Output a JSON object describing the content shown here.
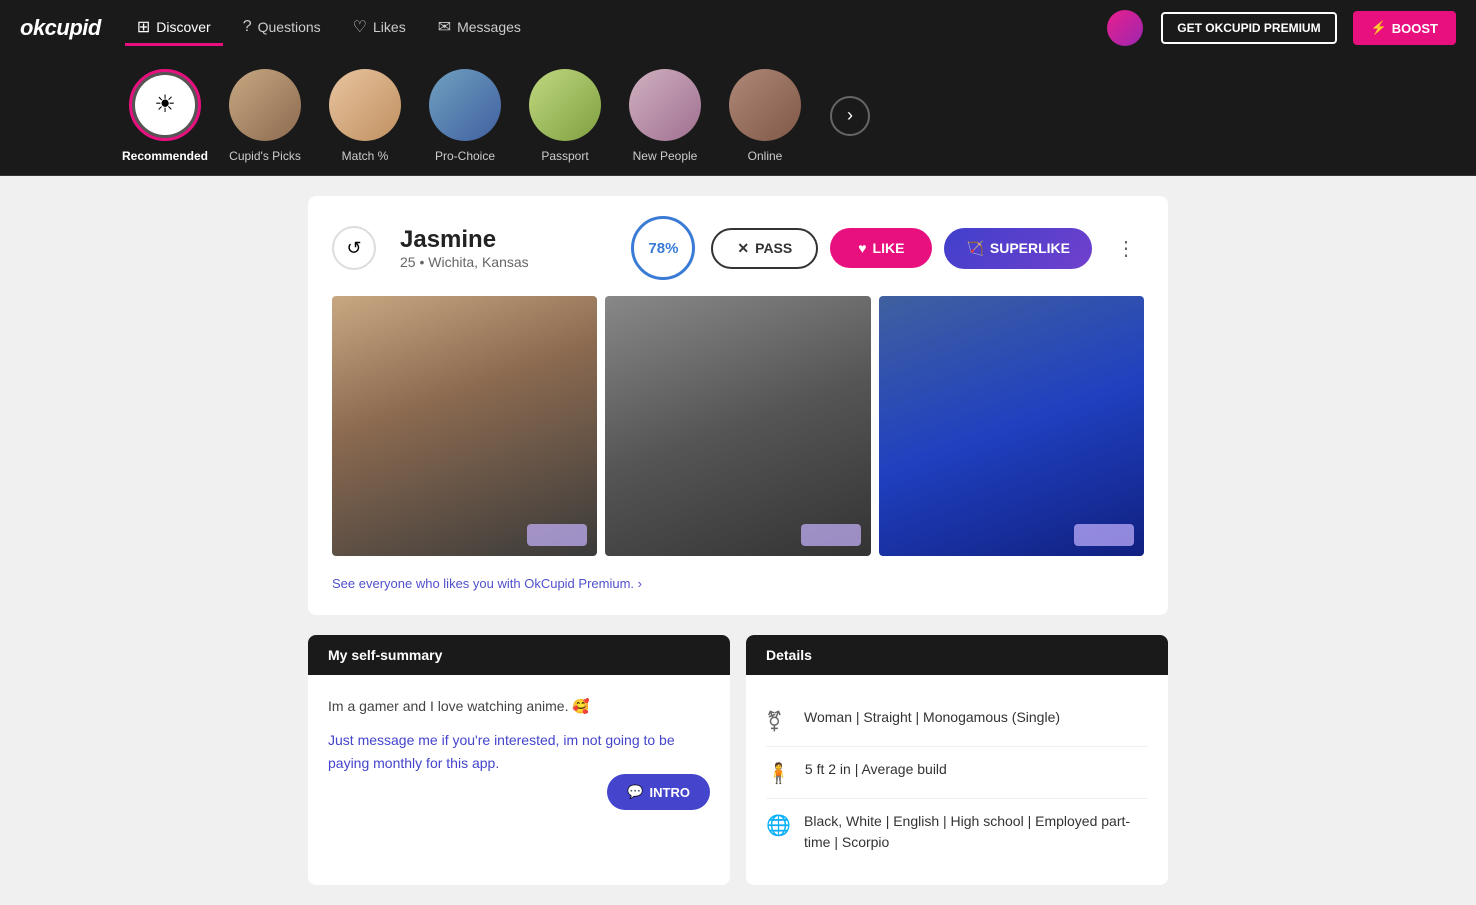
{
  "app": {
    "logo": "okcupid",
    "nav": {
      "items": [
        {
          "label": "Discover",
          "icon": "⊞",
          "active": true
        },
        {
          "label": "Questions",
          "icon": "❓",
          "active": false
        },
        {
          "label": "Likes",
          "icon": "♡",
          "active": false
        },
        {
          "label": "Messages",
          "icon": "💬",
          "active": false
        }
      ],
      "premium_btn": "GET OKCUPID PREMIUM",
      "boost_btn": "⚡ BOOST"
    },
    "discover_bar": {
      "items": [
        {
          "label": "Recommended",
          "type": "icon",
          "active": true
        },
        {
          "label": "Cupid's Picks",
          "type": "avatar",
          "class": "p1"
        },
        {
          "label": "Match %",
          "type": "avatar",
          "class": "p2"
        },
        {
          "label": "Pro-Choice",
          "type": "avatar",
          "class": "p3"
        },
        {
          "label": "Passport",
          "type": "avatar",
          "class": "p4"
        },
        {
          "label": "New People",
          "type": "avatar",
          "class": "p5"
        },
        {
          "label": "Online",
          "type": "avatar",
          "class": "p6"
        }
      ],
      "next_label": "›"
    }
  },
  "profile": {
    "name": "Jasmine",
    "age": "25",
    "location": "Wichita, Kansas",
    "match_percent": "78%",
    "actions": {
      "pass": "PASS",
      "like": "LIKE",
      "superlike": "SUPERLIKE"
    },
    "premium_link": "See everyone who likes you with OkCupid Premium. ›",
    "self_summary": {
      "header": "My self-summary",
      "text1": "Im a gamer and I love watching anime. 🥰",
      "text2": "Just message me if you're interested, im not going to be paying monthly for this app.",
      "intro_btn": "💬 INTRO"
    },
    "details": {
      "header": "Details",
      "rows": [
        {
          "icon": "⚧",
          "text": "Woman | Straight | Monogamous (Single)"
        },
        {
          "icon": "🧍",
          "text": "5 ft 2 in | Average build"
        },
        {
          "icon": "🌐",
          "text": "Black, White | English | High school | Employed part-time | Scorpio"
        }
      ]
    }
  }
}
